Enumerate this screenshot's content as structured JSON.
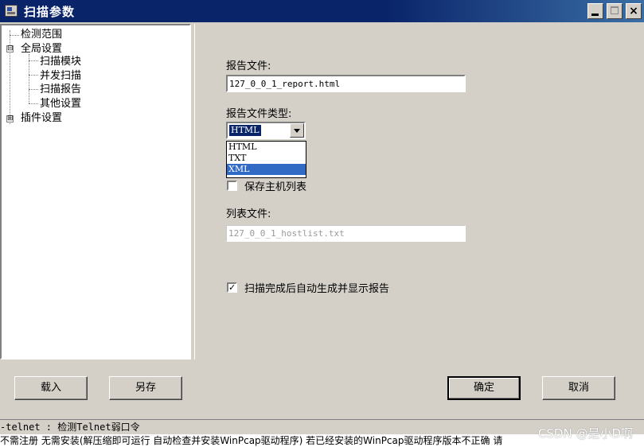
{
  "window": {
    "title": "扫描参数",
    "minimize_icon": "minimize-icon",
    "maximize_icon": "maximize-icon",
    "close_label": "×"
  },
  "tree": {
    "items": [
      {
        "label": "检测范围"
      },
      {
        "label": "全局设置",
        "expander": "⊟"
      },
      {
        "label": "扫描模块"
      },
      {
        "label": "并发扫描"
      },
      {
        "label": "扫描报告"
      },
      {
        "label": "其他设置"
      },
      {
        "label": "插件设置",
        "expander": "⊞"
      }
    ]
  },
  "form": {
    "report_file_label": "报告文件:",
    "report_file_value": "127_0_0_1_report.html",
    "report_type_label": "报告文件类型:",
    "report_type_selected": "HTML",
    "report_type_options": [
      "HTML",
      "TXT",
      "XML"
    ],
    "save_hosts_label": "保存主机列表",
    "list_file_label": "列表文件:",
    "list_file_value": "127_0_0_1_hostlist.txt",
    "auto_report_label": "扫描完成后自动生成并显示报告",
    "auto_report_check": "✓"
  },
  "buttons": {
    "load": "载入",
    "save_as": "另存",
    "ok": "确定",
    "cancel": "取消"
  },
  "status": {
    "line": "-telnet    : 检测Telnet弱口令",
    "description": "不需注册 无需安装(解压缩即可运行 自动检查并安装WinPcap驱动程序) 若已经安装的WinPcap驱动程序版本不正确 请"
  },
  "watermark": "CSDN @是小D啊"
}
